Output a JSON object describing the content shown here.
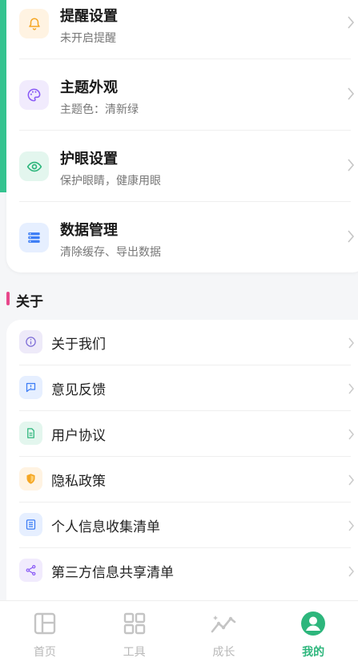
{
  "settings": {
    "items": [
      {
        "title": "提醒设置",
        "subtitle": "未开启提醒",
        "icon": "bell-icon"
      },
      {
        "title": "主题外观",
        "subtitle": "主题色：清新绿",
        "icon": "palette-icon"
      },
      {
        "title": "护眼设置",
        "subtitle": "保护眼睛，健康用眼",
        "icon": "eye-icon"
      },
      {
        "title": "数据管理",
        "subtitle": "清除缓存、导出数据",
        "icon": "database-icon"
      }
    ]
  },
  "about": {
    "title": "关于",
    "items": [
      {
        "label": "关于我们",
        "icon": "info-icon"
      },
      {
        "label": "意见反馈",
        "icon": "feedback-icon"
      },
      {
        "label": "用户协议",
        "icon": "document-icon"
      },
      {
        "label": "隐私政策",
        "icon": "shield-icon"
      },
      {
        "label": "个人信息收集清单",
        "icon": "list-icon"
      },
      {
        "label": "第三方信息共享清单",
        "icon": "share-icon"
      }
    ]
  },
  "tabbar": {
    "tabs": [
      {
        "label": "首页",
        "icon": "home-layout-icon"
      },
      {
        "label": "工具",
        "icon": "grid-icon"
      },
      {
        "label": "成长",
        "icon": "trend-icon"
      },
      {
        "label": "我的",
        "icon": "user-icon"
      }
    ],
    "active": "我的"
  },
  "colors": {
    "accent_green": "#2db67c",
    "section_bar": "#e8478b"
  }
}
